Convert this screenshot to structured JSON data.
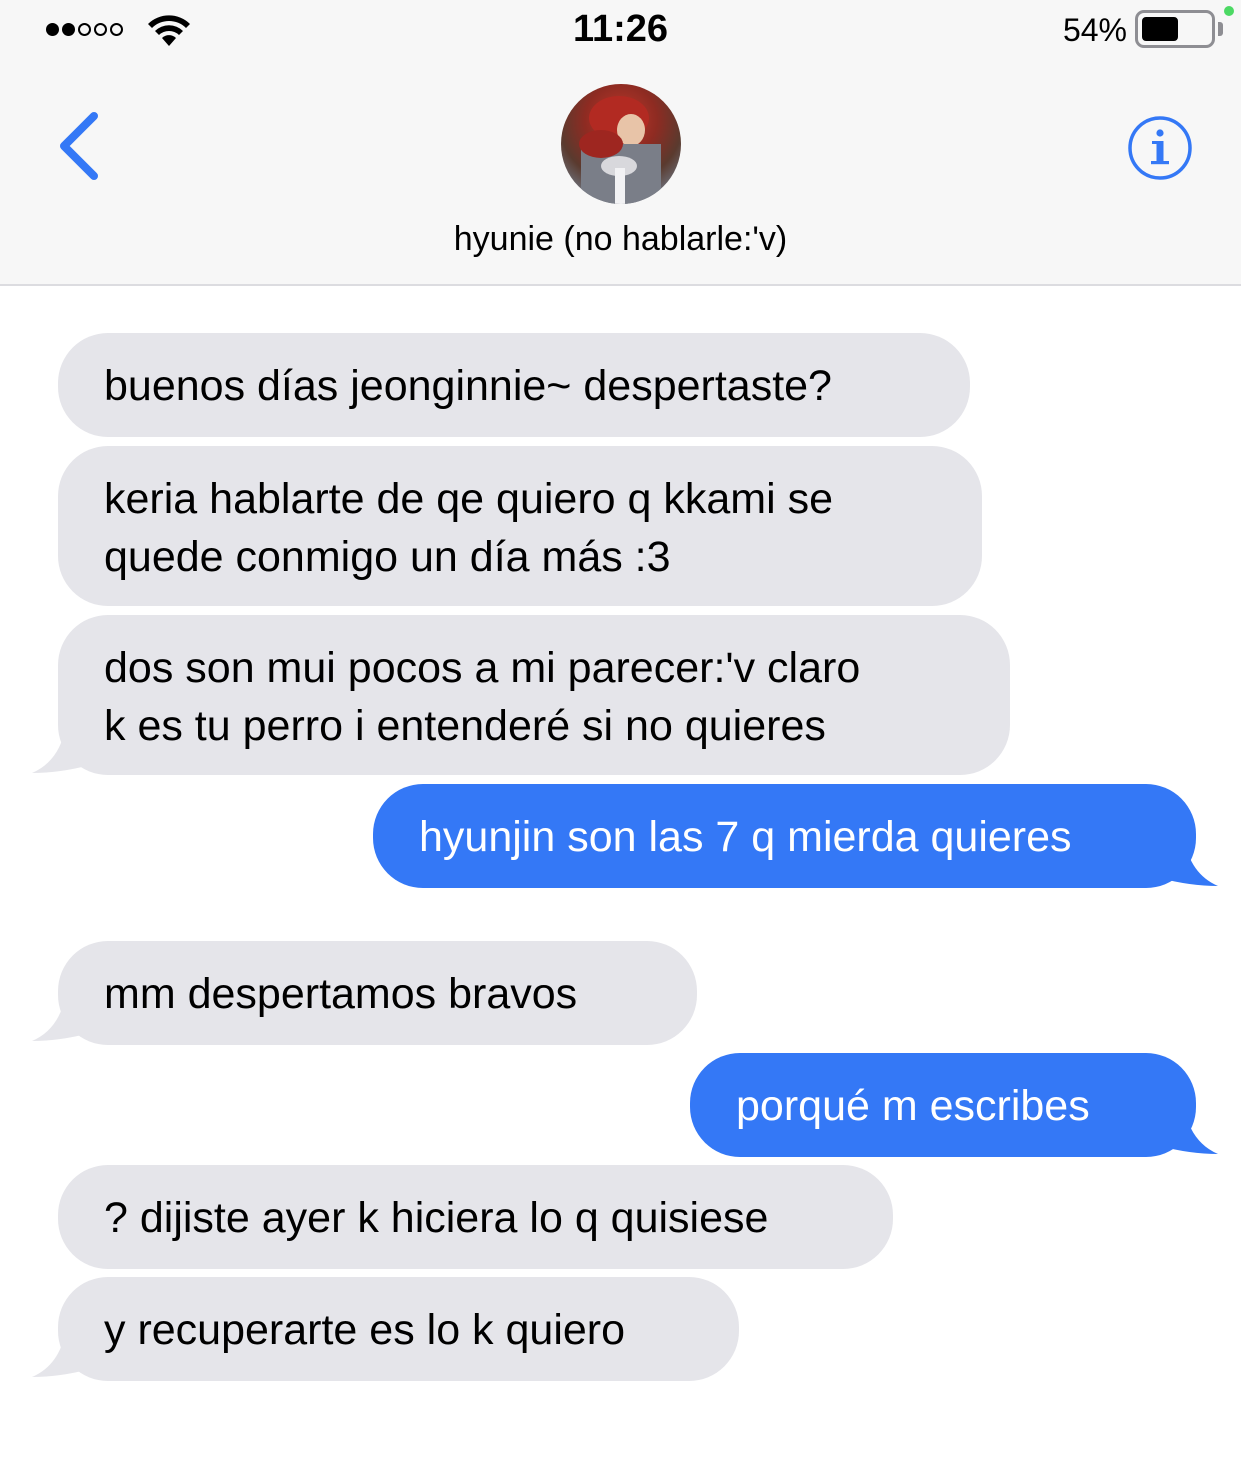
{
  "status_bar": {
    "time": "11:26",
    "battery_percent": "54%",
    "battery_level": 0.54,
    "signal_bars_filled": 2,
    "signal_bars_total": 5
  },
  "header": {
    "contact_name": "hyunie (no hablarle:'v)",
    "back_icon": "chevron-left-icon",
    "info_icon": "info-icon",
    "accent_color": "#3478f6"
  },
  "messages": [
    {
      "direction": "incoming",
      "text": "buenos días jeonginnie~ despertaste?"
    },
    {
      "direction": "incoming",
      "line1": "keria hablarte de qe quiero q kkami se",
      "line2": "quede conmigo un día más :3"
    },
    {
      "direction": "incoming",
      "line1": "dos son mui pocos a mi parecer:'v claro",
      "line2": "k es tu perro i entenderé si no quieres"
    },
    {
      "direction": "outgoing",
      "text": "hyunjin son las 7 q mierda quieres"
    },
    {
      "direction": "incoming",
      "text": "mm despertamos bravos"
    },
    {
      "direction": "outgoing",
      "text": "porqué m escribes"
    },
    {
      "direction": "incoming",
      "text": "? dijiste ayer k hiciera lo q quisiese"
    },
    {
      "direction": "incoming",
      "text": "y recuperarte es lo k quiero"
    }
  ],
  "colors": {
    "incoming_bubble": "#e5e5ea",
    "outgoing_bubble": "#3478f6",
    "header_background": "#f7f7f7"
  }
}
